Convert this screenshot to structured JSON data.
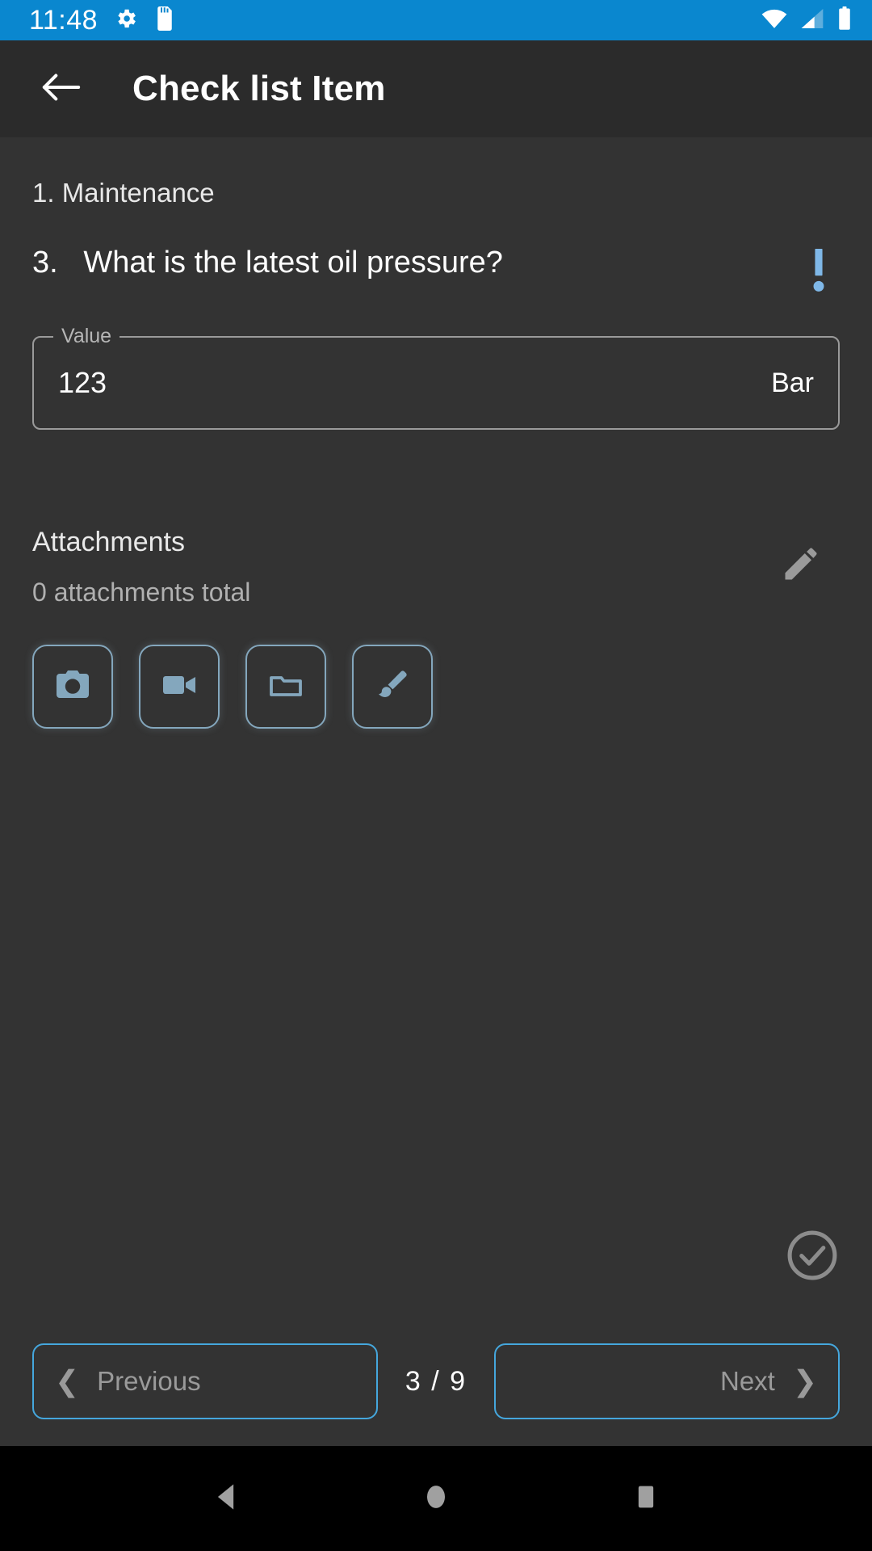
{
  "status_bar": {
    "clock": "11:48",
    "background_color": "#0a87cf",
    "icons": [
      "gear-icon",
      "sd-card-icon",
      "wifi-icon",
      "cellular-signal-icon",
      "battery-icon"
    ]
  },
  "toolbar": {
    "title": "Check list Item",
    "back_icon": "arrow-left-icon",
    "background_color": "#2b2b2b"
  },
  "content": {
    "section_title": "1. Maintenance",
    "question": {
      "text": "3.   What is the latest oil pressure?",
      "alert_icon": "exclamation-icon",
      "alert_color": "#7fb8e8"
    },
    "value_field": {
      "label": "Value",
      "value": "123",
      "unit": "Bar",
      "placeholder": "Value"
    },
    "attachments": {
      "title": "Attachments",
      "subtitle": "0 attachments total",
      "edit_icon": "pencil-icon",
      "buttons": [
        {
          "name": "camera",
          "icon": "camera-icon"
        },
        {
          "name": "video",
          "icon": "video-camera-icon"
        },
        {
          "name": "folder",
          "icon": "folder-icon"
        },
        {
          "name": "draw",
          "icon": "paint-brush-icon"
        }
      ],
      "accent_color": "#84a7bd"
    },
    "confirm": {
      "icon": "check-circle-icon",
      "color": "#8c8c8c"
    }
  },
  "bottom_nav": {
    "previous_label": "Previous",
    "previous_chevron": "chevron-left-icon",
    "next_label": "Next",
    "next_chevron": "chevron-right-icon",
    "page_counter": "3 / 9",
    "border_color": "#45a7dd"
  },
  "android_nav": {
    "back": "triangle-back-icon",
    "home": "circle-home-icon",
    "recents": "square-recents-icon"
  }
}
